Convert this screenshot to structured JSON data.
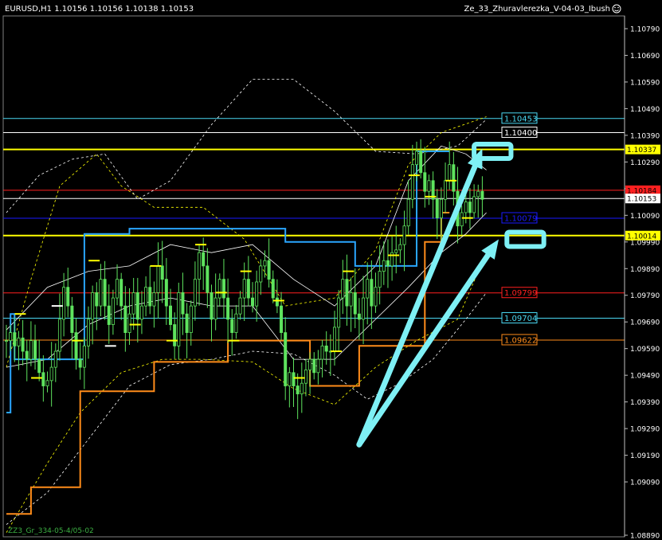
{
  "header": {
    "symbol_info": "EURUSD,H1  1.10156 1.10156 1.10138 1.10153",
    "indicator_name": "Ze_33_Zhuravlerezka_V-04-03_Ibush",
    "face_icon": "smiley-icon"
  },
  "footer": {
    "watermark": "ZZ3_Gr_334-05-4/05-02"
  },
  "colors": {
    "background": "#000000",
    "axis": "#c0c0c0",
    "candle": "#5ee35e",
    "yellow": "#ffff00",
    "red": "#ff2020",
    "blue": "#1a1aff",
    "cyan": "#4ad8f2",
    "orange": "#ff8c1a",
    "dodger": "#2aa6ff",
    "arrow": "#7ef0f5"
  },
  "chart_data": {
    "type": "candlestick",
    "ylim": [
      1.0885,
      1.0886
    ],
    "y_ticks": [
      1.0889,
      1.0909,
      1.0919,
      1.0929,
      1.0939,
      1.0949,
      1.0959,
      1.0969,
      1.0979,
      1.0989,
      1.0999,
      1.1009,
      1.1019,
      1.1029,
      1.1039,
      1.1049,
      1.1059,
      1.1069,
      1.1079
    ],
    "y_tick_labels": [
      "1.08890",
      "1.09090",
      "1.09190",
      "1.09290",
      "1.09390",
      "1.09490",
      "1.09590",
      "1.09690",
      "1.09790",
      "1.09890",
      "1.09990",
      "1.10090",
      "1.10190",
      "1.10290",
      "1.10390",
      "1.10490",
      "1.10590",
      "1.10690",
      "1.10790"
    ],
    "levels": [
      {
        "label": "1.10453",
        "value": 1.10453,
        "color": "cyan",
        "style": "line"
      },
      {
        "label": "1.10400",
        "value": 1.104,
        "color": "white",
        "style": "line"
      },
      {
        "label": "1.10337",
        "value": 1.10337,
        "color": "yellow",
        "style": "thick",
        "filled": true
      },
      {
        "label": "1.10184",
        "value": 1.10184,
        "color": "red",
        "style": "line",
        "filled": true
      },
      {
        "label": "1.10153",
        "value": 1.10153,
        "color": "white",
        "style": "line",
        "filled": true
      },
      {
        "label": "1.10079",
        "value": 1.10079,
        "color": "blue",
        "style": "line"
      },
      {
        "label": "1.10014",
        "value": 1.10014,
        "color": "yellow",
        "style": "thick",
        "filled": true
      },
      {
        "label": "1.09799",
        "value": 1.09799,
        "color": "red",
        "style": "line"
      },
      {
        "label": "1.09704",
        "value": 1.09704,
        "color": "cyan",
        "style": "line"
      },
      {
        "label": "1.09622",
        "value": 1.09622,
        "color": "orange",
        "style": "line"
      }
    ],
    "price_path": [
      1.0962,
      1.0965,
      1.096,
      1.0963,
      1.0958,
      1.0955,
      1.0962,
      1.0955,
      1.095,
      1.0945,
      1.0947,
      1.0952,
      1.0958,
      1.097,
      1.0982,
      1.0975,
      1.0965,
      1.0955,
      1.0952,
      1.096,
      1.097,
      1.098,
      1.0975,
      1.0985,
      1.0975,
      1.0968,
      1.0978,
      1.0985,
      1.0975,
      1.0965,
      1.0972,
      1.098,
      1.097,
      1.0975,
      1.0982,
      1.0975,
      1.098,
      1.099,
      1.0985,
      1.0975,
      1.0968,
      1.096,
      1.098,
      1.0972,
      1.0965,
      1.0975,
      1.0985,
      1.0995,
      1.099,
      1.098,
      1.097,
      1.0978,
      1.0985,
      1.0978,
      1.097,
      1.0965,
      1.0972,
      1.0978,
      1.0985,
      1.0978,
      1.0975,
      1.0984,
      1.099,
      1.0992,
      1.0985,
      1.0978,
      1.0975,
      1.0965,
      1.0945,
      1.095,
      1.0945,
      1.0942,
      1.0946,
      1.0951,
      1.0955,
      1.095,
      1.0955,
      1.096,
      1.0958,
      1.0958,
      1.0967,
      1.0978,
      1.0985,
      1.0975,
      1.098,
      1.0972,
      1.097,
      1.0978,
      1.0985,
      1.0975,
      1.0982,
      1.0988,
      1.0992,
      1.099,
      1.0995,
      1.0996,
      1.0998,
      1.1005,
      1.1015,
      1.1028,
      1.1033,
      1.1025,
      1.1018,
      1.1022,
      1.1015,
      1.1008,
      1.1015,
      1.1022,
      1.1028,
      1.1018,
      1.1005,
      1.101,
      1.1014,
      1.101,
      1.1016,
      1.1018,
      1.1015
    ],
    "channels": [
      {
        "name": "outer-upper",
        "color": "yellow",
        "dash": true,
        "points": [
          [
            0,
            1.0952
          ],
          [
            6,
            1.0985
          ],
          [
            13,
            1.102
          ],
          [
            22,
            1.1032
          ],
          [
            28,
            1.102
          ],
          [
            36,
            1.1012
          ],
          [
            48,
            1.1012
          ],
          [
            58,
            1.1
          ],
          [
            68,
            1.0975
          ],
          [
            80,
            1.0978
          ],
          [
            90,
            1.0996
          ],
          [
            98,
            1.1028
          ],
          [
            106,
            1.104
          ],
          [
            117,
            1.1046
          ]
        ]
      },
      {
        "name": "outer-lower",
        "color": "yellow",
        "dash": true,
        "points": [
          [
            0,
            1.089
          ],
          [
            10,
            1.0916
          ],
          [
            18,
            1.0935
          ],
          [
            28,
            1.095
          ],
          [
            38,
            1.0955
          ],
          [
            48,
            1.0955
          ],
          [
            60,
            1.0954
          ],
          [
            70,
            1.0944
          ],
          [
            80,
            1.0938
          ],
          [
            90,
            1.0952
          ],
          [
            100,
            1.0962
          ],
          [
            110,
            1.097
          ],
          [
            117,
            1.0995
          ]
        ]
      },
      {
        "name": "wide-upper",
        "color": "white",
        "dash": true,
        "points": [
          [
            0,
            1.101
          ],
          [
            8,
            1.1024
          ],
          [
            16,
            1.103
          ],
          [
            24,
            1.1032
          ],
          [
            32,
            1.1015
          ],
          [
            40,
            1.1022
          ],
          [
            50,
            1.1043
          ],
          [
            60,
            1.106
          ],
          [
            70,
            1.106
          ],
          [
            80,
            1.1048
          ],
          [
            90,
            1.1033
          ],
          [
            100,
            1.1032
          ],
          [
            110,
            1.1035
          ],
          [
            117,
            1.1045
          ]
        ]
      },
      {
        "name": "wide-lower",
        "color": "white",
        "dash": true,
        "points": [
          [
            0,
            1.0893
          ],
          [
            10,
            1.0905
          ],
          [
            20,
            1.0925
          ],
          [
            30,
            1.0945
          ],
          [
            40,
            1.0953
          ],
          [
            50,
            1.0955
          ],
          [
            60,
            1.0958
          ],
          [
            70,
            1.0957
          ],
          [
            80,
            1.0949
          ],
          [
            88,
            1.094
          ],
          [
            96,
            1.0946
          ],
          [
            104,
            1.0955
          ],
          [
            112,
            1.097
          ],
          [
            117,
            1.098
          ]
        ]
      },
      {
        "name": "inner-upper",
        "color": "white",
        "dash": false,
        "points": [
          [
            0,
            1.0966
          ],
          [
            10,
            1.0982
          ],
          [
            20,
            1.0988
          ],
          [
            30,
            1.099
          ],
          [
            40,
            1.0998
          ],
          [
            50,
            1.0995
          ],
          [
            60,
            1.0998
          ],
          [
            70,
            1.0985
          ],
          [
            80,
            1.0975
          ],
          [
            90,
            1.099
          ],
          [
            98,
            1.1022
          ],
          [
            106,
            1.1035
          ],
          [
            112,
            1.1032
          ],
          [
            117,
            1.1026
          ]
        ]
      },
      {
        "name": "inner-lower",
        "color": "white",
        "dash": false,
        "points": [
          [
            0,
            1.0952
          ],
          [
            10,
            1.0955
          ],
          [
            20,
            1.0968
          ],
          [
            30,
            1.0975
          ],
          [
            40,
            1.0978
          ],
          [
            50,
            1.0975
          ],
          [
            60,
            1.0975
          ],
          [
            70,
            1.0955
          ],
          [
            80,
            1.0955
          ],
          [
            90,
            1.097
          ],
          [
            98,
            1.0982
          ],
          [
            106,
            1.0995
          ],
          [
            112,
            1.1002
          ],
          [
            117,
            1.101
          ]
        ]
      }
    ],
    "steps": {
      "dodger": [
        [
          0,
          1.0935
        ],
        [
          1,
          1.0935
        ],
        [
          1,
          1.0972
        ],
        [
          2,
          1.0972
        ],
        [
          2,
          1.0955
        ],
        [
          19,
          1.0955
        ],
        [
          19,
          1.1002
        ],
        [
          30,
          1.1002
        ],
        [
          30,
          1.1004
        ],
        [
          68,
          1.1004
        ],
        [
          68,
          1.0999
        ],
        [
          85,
          1.0999
        ],
        [
          85,
          1.099
        ],
        [
          100,
          1.099
        ],
        [
          100,
          1.1033
        ],
        [
          108,
          1.1033
        ]
      ],
      "orange": [
        [
          0,
          1.0897
        ],
        [
          6,
          1.0897
        ],
        [
          6,
          1.0907
        ],
        [
          18,
          1.0907
        ],
        [
          18,
          1.0943
        ],
        [
          36,
          1.0943
        ],
        [
          36,
          1.0954
        ],
        [
          54,
          1.0954
        ],
        [
          54,
          1.0962
        ],
        [
          74,
          1.0962
        ],
        [
          74,
          1.0945
        ],
        [
          86,
          1.0945
        ],
        [
          86,
          1.096
        ],
        [
          102,
          1.096
        ],
        [
          102,
          1.0999
        ],
        [
          106,
          1.0999
        ],
        [
          106,
          1.101
        ],
        [
          108,
          1.101
        ]
      ]
    },
    "fractal_ticks": [
      {
        "i": 3,
        "v": 1.0972,
        "c": "yellow"
      },
      {
        "i": 7,
        "v": 1.0948,
        "c": "yellow"
      },
      {
        "i": 12,
        "v": 1.0975,
        "c": "white"
      },
      {
        "i": 17,
        "v": 1.0962,
        "c": "yellow"
      },
      {
        "i": 21,
        "v": 1.0992,
        "c": "yellow"
      },
      {
        "i": 25,
        "v": 1.096,
        "c": "white"
      },
      {
        "i": 31,
        "v": 1.0968,
        "c": "yellow"
      },
      {
        "i": 36,
        "v": 1.099,
        "c": "yellow"
      },
      {
        "i": 40,
        "v": 1.0962,
        "c": "yellow"
      },
      {
        "i": 47,
        "v": 1.0998,
        "c": "yellow"
      },
      {
        "i": 52,
        "v": 1.098,
        "c": "yellow"
      },
      {
        "i": 55,
        "v": 1.0962,
        "c": "yellow"
      },
      {
        "i": 58,
        "v": 1.0988,
        "c": "yellow"
      },
      {
        "i": 66,
        "v": 1.0977,
        "c": "yellow"
      },
      {
        "i": 71,
        "v": 1.0948,
        "c": "yellow"
      },
      {
        "i": 80,
        "v": 1.0958,
        "c": "yellow"
      },
      {
        "i": 83,
        "v": 1.0988,
        "c": "yellow"
      },
      {
        "i": 94,
        "v": 1.0994,
        "c": "yellow"
      },
      {
        "i": 99,
        "v": 1.1024,
        "c": "yellow"
      },
      {
        "i": 103,
        "v": 1.1016,
        "c": "yellow"
      },
      {
        "i": 108,
        "v": 1.1022,
        "c": "yellow"
      },
      {
        "i": 112,
        "v": 1.1008,
        "c": "yellow"
      }
    ],
    "arrows": [
      {
        "from": [
          86,
          1.0923
        ],
        "to": [
          116,
          1.1034
        ]
      },
      {
        "from": [
          86,
          1.0923
        ],
        "to": [
          120,
          1.1
        ]
      }
    ],
    "highlight_boxes": [
      {
        "x_from": 114,
        "x_to": 123,
        "value": 1.1033
      },
      {
        "x_from": 122,
        "x_to": 131,
        "value": 1.1
      }
    ]
  }
}
